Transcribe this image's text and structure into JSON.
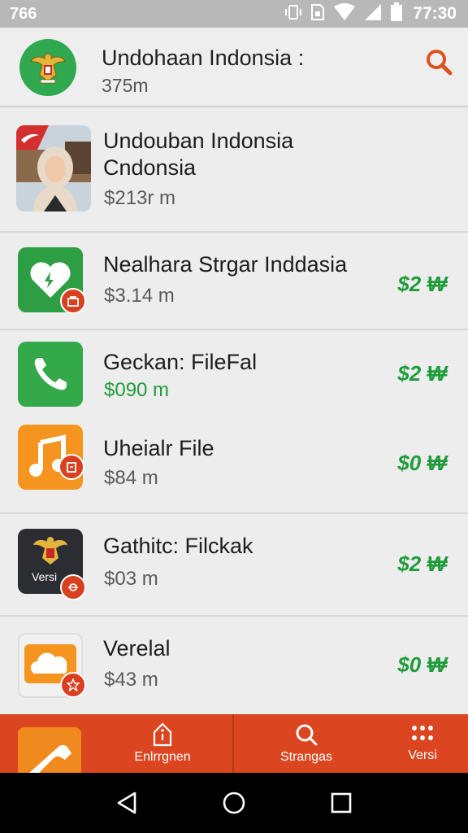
{
  "status_bar": {
    "left_text": "766",
    "time": "77:30"
  },
  "header": {
    "title": "Undohaan Indonsia :",
    "subtitle": "375m"
  },
  "items": [
    {
      "title_line1": "Undouban Indonsia",
      "title_line2": "Cndonsia",
      "subtitle": "$213r m",
      "price": ""
    },
    {
      "title_line1": "Nealhara Strgar Inddasia",
      "subtitle": "$3.14 m",
      "price": "$2 ₩"
    },
    {
      "title_line1": "Geckan: FileFal",
      "subtitle": "$090 m",
      "price": "$2 ₩"
    },
    {
      "title_line1": "Uheialr File",
      "subtitle": "$84 m",
      "price": "$0 ₩"
    },
    {
      "title_line1": "Gathitc: Filckak",
      "subtitle": "$03 m",
      "price": "$2 ₩",
      "thumb_text": "Versi"
    },
    {
      "title_line1": "Verelal",
      "subtitle": "$43 m",
      "price": "$0 ₩"
    }
  ],
  "bottom_nav": [
    {
      "label": "Enlrrgnen",
      "icon": "upload-icon"
    },
    {
      "label": "Strangas",
      "icon": "search-icon"
    },
    {
      "label": "Versi",
      "icon": "grid-icon"
    }
  ],
  "colors": {
    "accent": "#db4520",
    "price_green": "#1f9c3a",
    "logo_green": "#2fa84f"
  }
}
